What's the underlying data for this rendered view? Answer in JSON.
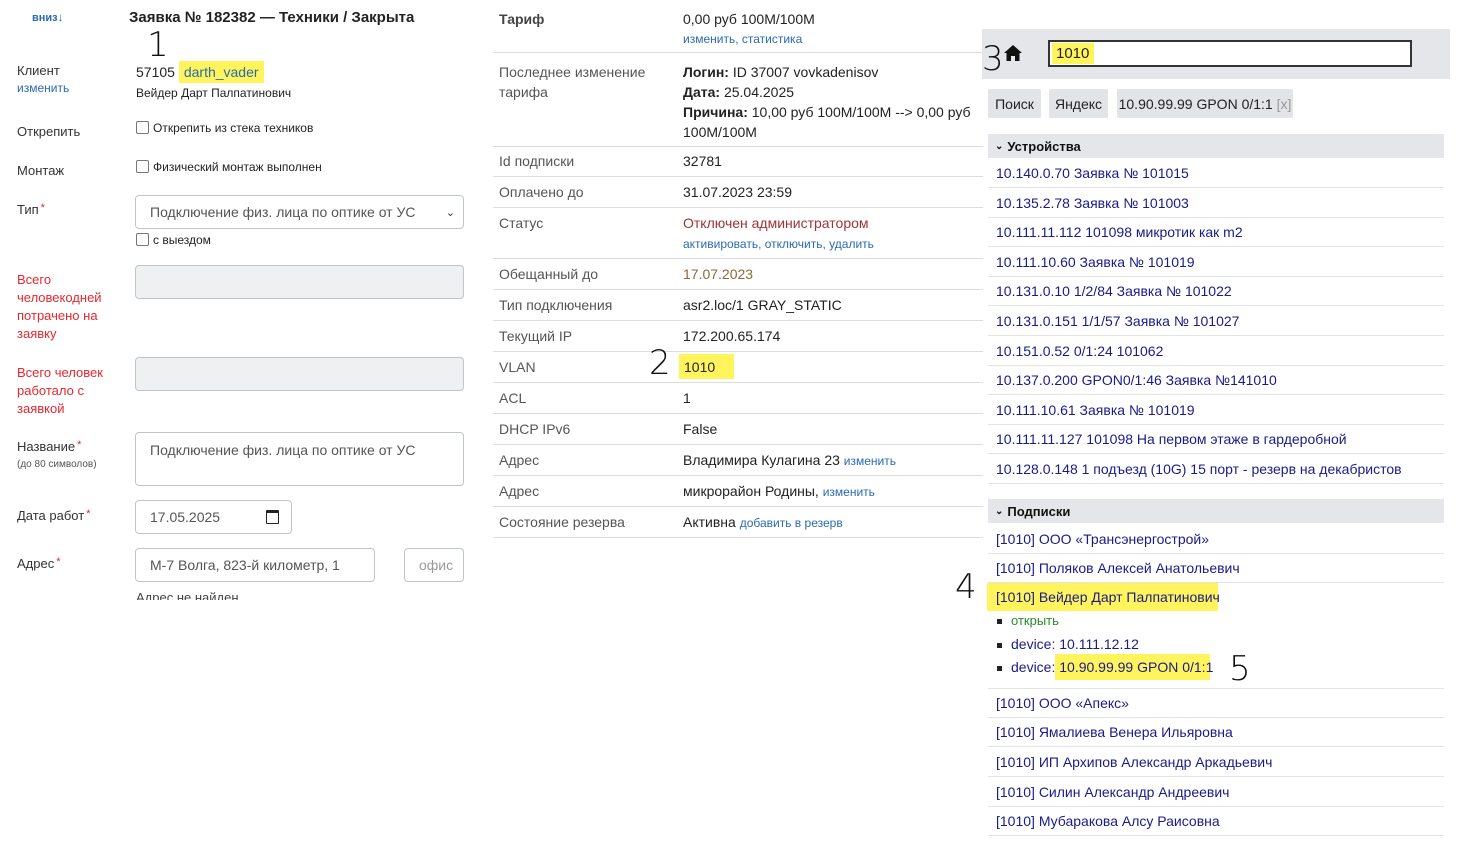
{
  "left": {
    "down_link": "вниз",
    "title": "Заявка № 182382 — Техники / Закрыта",
    "client_label": "Клиент",
    "client_change": "изменить",
    "client_id": "57105",
    "client_login": "darth_vader",
    "client_name": "Вейдер Дарт Палпатинович",
    "detach_label": "Открепить",
    "detach_checkbox": "Открепить из стека техников",
    "mount_label": "Монтаж",
    "mount_checkbox": "Физический монтаж выполнен",
    "type_label": "Тип",
    "type_value": "Подключение физ. лица по оптике от УС",
    "departure_checkbox": "с выездом",
    "mandays_label": "Всего человекодней потрачено на заявку",
    "people_label": "Всего человек работало с заявкой",
    "name_label": "Название",
    "name_hint": "(до 80 символов)",
    "name_value": "Подключение физ. лица по оптике от УС",
    "date_label": "Дата работ",
    "date_value": "17.05.2025",
    "address_label": "Адрес",
    "address_value": "М-7 Волга, 823-й километр, 1",
    "office_placeholder": "офис",
    "address_not_found": "Адрес не найден",
    "required_mark": "*"
  },
  "middle": {
    "tariff_label": "Тариф",
    "tariff_value": "0,00 руб 100M/100M",
    "tariff_change": "изменить",
    "tariff_stats": "статистика",
    "last_change_label": "Последнее изменение тарифа",
    "login_key": "Логин:",
    "login_value": "ID 37007 vovkadenisov",
    "date_key": "Дата:",
    "date_value": "25.04.2025",
    "reason_key": "Причина:",
    "reason_value": "10,00 руб 100M/100M --> 0,00 руб 100M/100M",
    "sub_id_label": "Id подписки",
    "sub_id_value": "32781",
    "paid_label": "Оплачено до",
    "paid_value": "31.07.2023 23:59",
    "status_label": "Статус",
    "status_value": "Отключен администратором",
    "status_activate": "активировать",
    "status_disable": "отключить",
    "status_delete": "удалить",
    "promised_label": "Обещанный до",
    "promised_value": "17.07.2023",
    "conn_type_label": "Тип подключения",
    "conn_type_value": "asr2.loc/1 GRAY_STATIC",
    "ip_label": "Текущий IP",
    "ip_value": "172.200.65.174",
    "vlan_label": "VLAN",
    "vlan_value": "1010",
    "acl_label": "ACL",
    "acl_value": "1",
    "dhcp_label": "DHCP IPv6",
    "dhcp_value": "False",
    "addr1_label": "Адрес",
    "addr1_value": "Владимира Кулагина 23",
    "addr1_change": "изменить",
    "addr2_label": "Адрес",
    "addr2_value": "микрорайон Родины,",
    "addr2_change": "изменить",
    "reserve_label": "Состояние резерва",
    "reserve_value": "Активна",
    "reserve_add": "добавить в резерв"
  },
  "right": {
    "search_value": "1010",
    "btn_search": "Поиск",
    "btn_yandex": "Яндекс",
    "chip_text": "10.90.99.99 GPON 0/1:1",
    "chip_close": "[x]",
    "devices_header": "Устройства",
    "devices": [
      "10.140.0.70 Заявка № 101015",
      "10.135.2.78 Заявка № 101003",
      "10.111.11.112 101098 микротик как m2",
      "10.111.10.60 Заявка № 101019",
      "10.131.0.10 1/2/84 Заявка № 101022",
      "10.131.0.151 1/1/57 Заявка № 101027",
      "10.151.0.52 0/1:24 101062",
      "10.137.0.200 GPON0/1:46 Заявка №141010",
      "10.111.10.61 Заявка № 101019",
      "10.111.11.127 101098 На первом этаже в гардеробной",
      "10.128.0.148 1 подъезд (10G) 15 порт - резерв на декабристов"
    ],
    "subs_header": "Подписки",
    "subs_before": [
      "[1010] ООО «Трансэнергострой»",
      "[1010] Поляков Алексей Анатольевич"
    ],
    "sub_highlight": "[1010] Вейдер Дарт Палпатинович",
    "sub_open": "открыть",
    "device_key": "device:",
    "device1": "10.111.12.12",
    "device2": "10.90.99.99 GPON 0/1:1",
    "subs_after": [
      "[1010] ООО «Апекс»",
      "[1010] Ямалиева Венера Ильяровна",
      "[1010] ИП Архипов Александр Аркадьевич",
      "[1010] Силин Александр Андреевич",
      "[1010] Мубаракова Алсу Раисовна"
    ]
  },
  "annotations": [
    "1",
    "2",
    "3",
    "4",
    "5"
  ]
}
